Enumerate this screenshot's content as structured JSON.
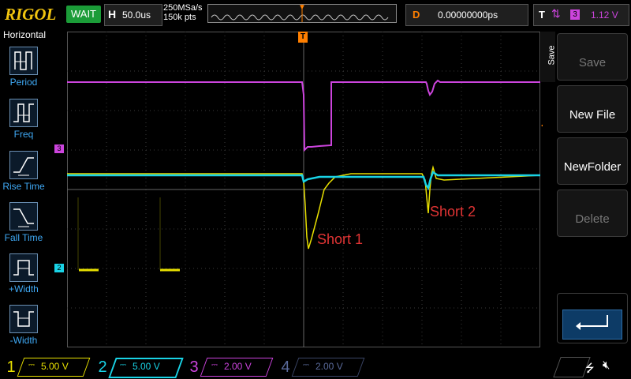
{
  "brand": "RIGOL",
  "status": {
    "run_state": "WAIT",
    "color": "#1b9c38"
  },
  "horizontal": {
    "label": "H",
    "timebase": "50.0us"
  },
  "sampling": {
    "rate": "250MSa/s",
    "points": "150k pts"
  },
  "delay": {
    "label": "D",
    "value": "0.00000000ps"
  },
  "trigger": {
    "label": "T",
    "source": "3",
    "level": "1.12 V",
    "edge_icon": "rising-falling-edge-icon",
    "color": "#cc44dd"
  },
  "left_menu": {
    "title": "Horizontal",
    "items": [
      {
        "label": "Period",
        "icon": "period-measure-icon"
      },
      {
        "label": "Freq",
        "icon": "frequency-measure-icon"
      },
      {
        "label": "Rise Time",
        "icon": "rise-time-icon"
      },
      {
        "label": "Fall Time",
        "icon": "fall-time-icon"
      },
      {
        "label": "+Width",
        "icon": "positive-width-icon"
      },
      {
        "label": "-Width",
        "icon": "negative-width-icon"
      }
    ]
  },
  "right_menu": {
    "tab": "Save",
    "buttons": [
      {
        "label": "Save",
        "enabled": false
      },
      {
        "label": "New File",
        "enabled": true
      },
      {
        "label": "NewFolder",
        "enabled": true
      },
      {
        "label": "Delete",
        "enabled": false
      }
    ],
    "return_icon": "return-arrow-icon"
  },
  "channels": [
    {
      "num": "1",
      "scale": "5.00 V",
      "color": "#e8e000",
      "active": true
    },
    {
      "num": "2",
      "scale": "5.00 V",
      "color": "#19d3e6",
      "active": true
    },
    {
      "num": "3",
      "scale": "2.00 V",
      "color": "#cc44dd",
      "active": true
    },
    {
      "num": "4",
      "scale": "2.00 V",
      "color": "#5a6a9a",
      "active": false
    }
  ],
  "channel_markers": [
    {
      "label": "3",
      "color": "#cc44dd"
    },
    {
      "label": "2",
      "color": "#19d3e6"
    }
  ],
  "trigger_marker": {
    "label": "T",
    "color": "#ff7f00"
  },
  "annotations": [
    {
      "text": "Short 1",
      "color": "#e03434"
    },
    {
      "text": "Short 2",
      "color": "#e03434"
    }
  ],
  "statusbar": {
    "usb_icon": "usb-icon",
    "sound_icon": "speaker-muted-icon"
  }
}
